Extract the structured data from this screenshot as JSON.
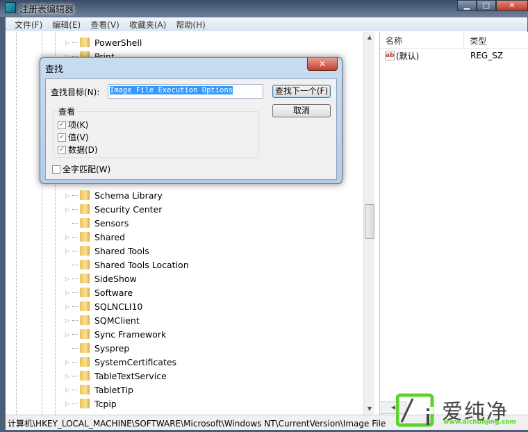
{
  "window": {
    "title": "注册表编辑器",
    "minimize": "▁",
    "maximize": "□",
    "close": "✕"
  },
  "menu": [
    "文件(F)",
    "编辑(E)",
    "查看(V)",
    "收藏夹(A)",
    "帮助(H)"
  ],
  "tree": {
    "items": [
      {
        "label": "PowerShell",
        "expandable": true
      },
      {
        "label": "Print",
        "expandable": true
      },
      {
        "label": "",
        "hidden": true
      },
      {
        "label": "",
        "hidden": true
      },
      {
        "label": "",
        "hidden": true
      },
      {
        "label": "",
        "hidden": true
      },
      {
        "label": "",
        "hidden": true
      },
      {
        "label": "",
        "hidden": true
      },
      {
        "label": "",
        "hidden": true
      },
      {
        "label": "",
        "hidden": true
      },
      {
        "label": "",
        "hidden": true
      },
      {
        "label": "Schema Library",
        "expandable": true
      },
      {
        "label": "Security Center",
        "expandable": true
      },
      {
        "label": "Sensors",
        "expandable": false
      },
      {
        "label": "Shared",
        "expandable": true
      },
      {
        "label": "Shared Tools",
        "expandable": true
      },
      {
        "label": "Shared Tools Location",
        "expandable": false
      },
      {
        "label": "SideShow",
        "expandable": true
      },
      {
        "label": "Software",
        "expandable": true
      },
      {
        "label": "SQLNCLI10",
        "expandable": true
      },
      {
        "label": "SQMClient",
        "expandable": true
      },
      {
        "label": "Sync Framework",
        "expandable": true
      },
      {
        "label": "Sysprep",
        "expandable": false
      },
      {
        "label": "SystemCertificates",
        "expandable": true
      },
      {
        "label": "TableTextService",
        "expandable": true
      },
      {
        "label": "TabletTip",
        "expandable": true
      },
      {
        "label": "Tcpip",
        "expandable": true
      }
    ]
  },
  "values": {
    "headers": [
      "名称",
      "类型"
    ],
    "rows": [
      {
        "name": "(默认)",
        "type": "REG_SZ",
        "icon": "string-value-icon"
      }
    ]
  },
  "status": "计算机\\HKEY_LOCAL_MACHINE\\SOFTWARE\\Microsoft\\Windows NT\\CurrentVersion\\Image File",
  "find_dialog": {
    "title": "查找",
    "find_label": "查找目标(N):",
    "find_value": "Image File Execution Options",
    "find_next": "查找下一个(F)",
    "cancel": "取消",
    "look_at": "查看",
    "options": [
      {
        "label": "项(K)",
        "checked": true
      },
      {
        "label": "值(V)",
        "checked": true
      },
      {
        "label": "数据(D)",
        "checked": true
      }
    ],
    "match_whole": {
      "label": "全字匹配(W)",
      "checked": false
    }
  },
  "watermark": {
    "text": "爱纯净",
    "url": "www.aichunjing.com",
    "color": "#5fd12f"
  }
}
